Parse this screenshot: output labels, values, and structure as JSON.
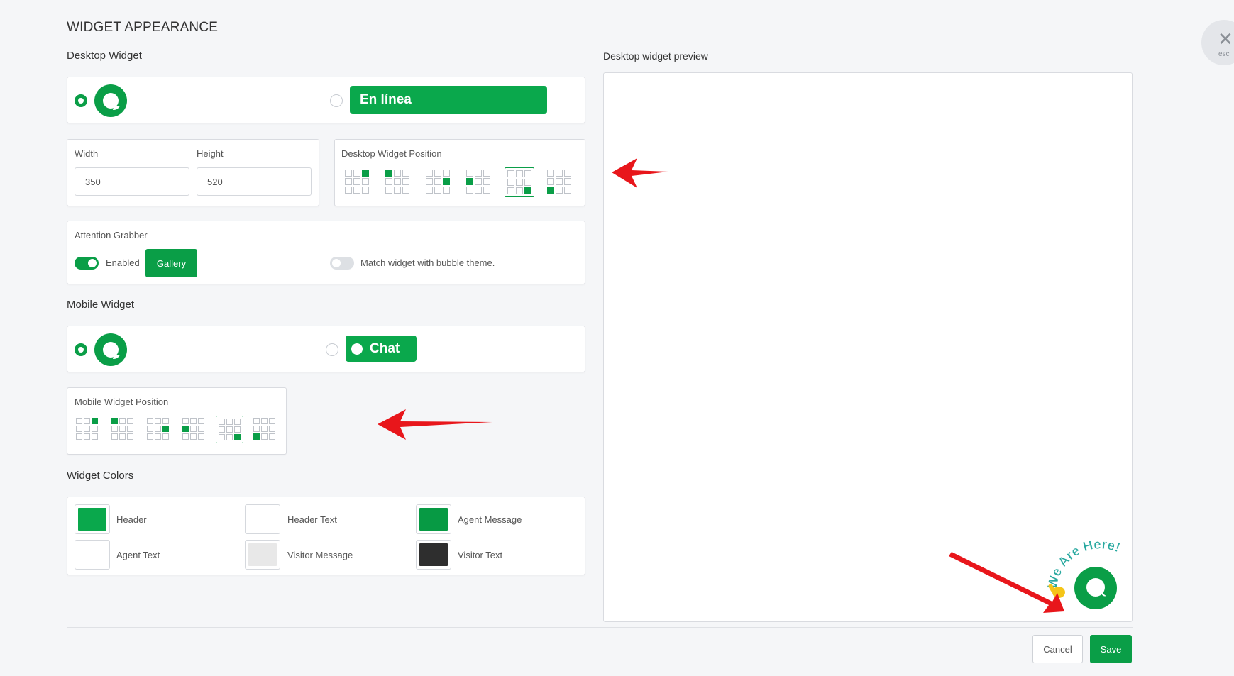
{
  "page": {
    "title": "WIDGET APPEARANCE"
  },
  "close": {
    "label": "esc",
    "icon": "close-icon"
  },
  "desktop": {
    "section_title": "Desktop Widget",
    "option_bubble_selected": true,
    "option_bar_label": "En línea",
    "size": {
      "width_label": "Width",
      "height_label": "Height",
      "width_value": "350",
      "height_value": "520"
    },
    "position": {
      "label": "Desktop Widget Position",
      "selected_index": 4
    }
  },
  "attention": {
    "label": "Attention Grabber",
    "enabled_label": "Enabled",
    "enabled": true,
    "gallery_label": "Gallery",
    "match_label": "Match widget with bubble theme.",
    "match_enabled": false
  },
  "mobile": {
    "section_title": "Mobile Widget",
    "option_bubble_selected": true,
    "option_bar_label": "Chat",
    "position": {
      "label": "Mobile Widget Position",
      "selected_index": 4
    }
  },
  "colors": {
    "section_title": "Widget Colors",
    "items": [
      {
        "label": "Header",
        "color": "#0aa84c"
      },
      {
        "label": "Header Text",
        "color": "#ffffff"
      },
      {
        "label": "Agent Message",
        "color": "#079a44"
      },
      {
        "label": "Agent Text",
        "color": "#ffffff"
      },
      {
        "label": "Visitor Message",
        "color": "#e8e8e8"
      },
      {
        "label": "Visitor Text",
        "color": "#2e2e2e"
      }
    ]
  },
  "preview": {
    "title": "Desktop widget preview",
    "grabber_text": "We Are Here!"
  },
  "footer": {
    "cancel_label": "Cancel",
    "save_label": "Save"
  },
  "theme": {
    "accent": "#0a9e47",
    "annotation_arrow": "#e8161b"
  }
}
